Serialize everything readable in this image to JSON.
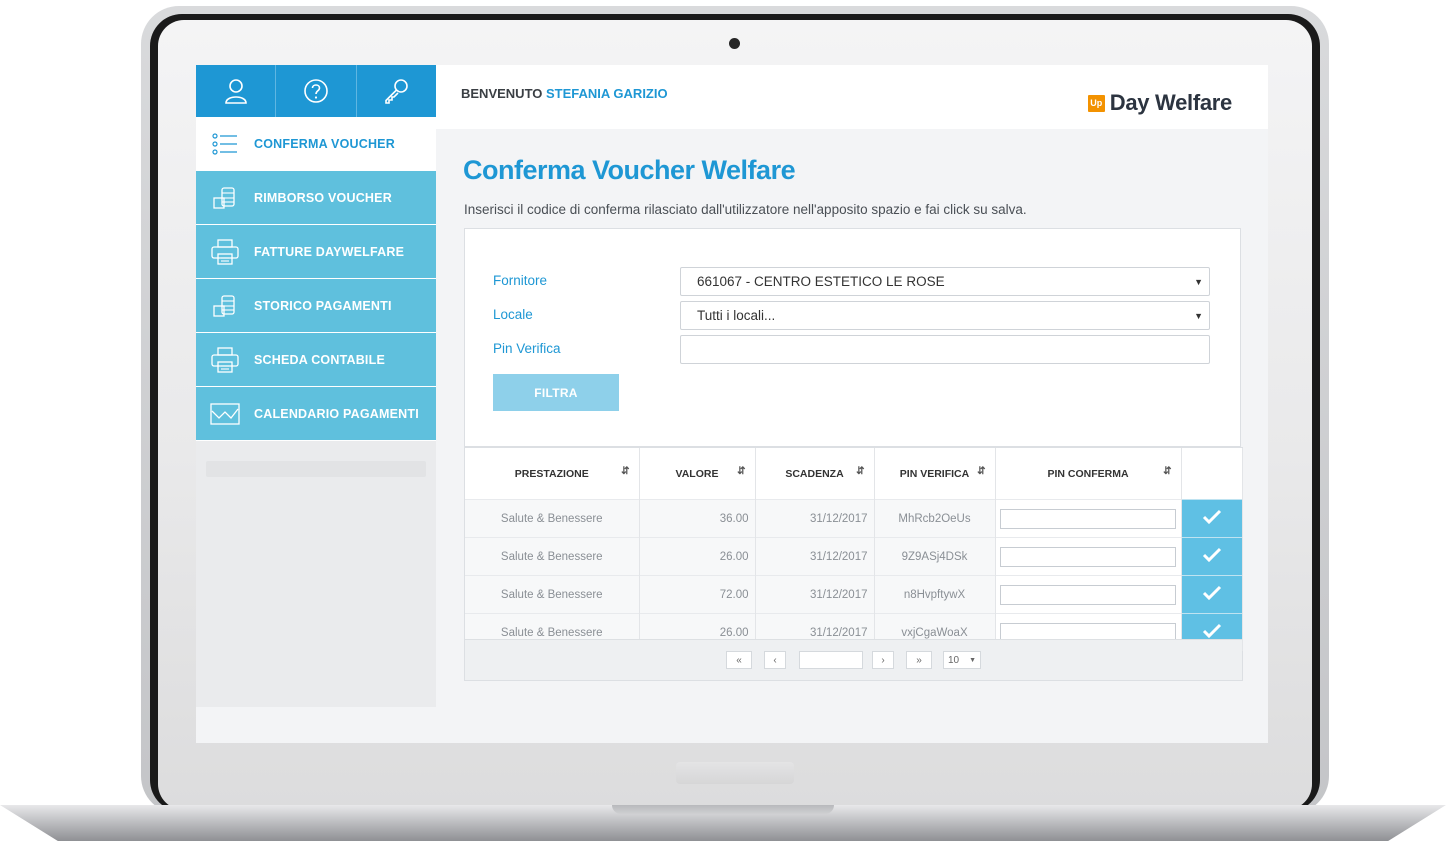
{
  "header": {
    "welcome_prefix": "BENVENUTO",
    "user_name": "STEFANIA GARIZIO",
    "brand_badge": "Up",
    "brand_name": "Day Welfare"
  },
  "sidebar": {
    "items": [
      {
        "label": "CONFERMA VOUCHER",
        "icon": "list-icon",
        "active": true
      },
      {
        "label": "RIMBORSO VOUCHER",
        "icon": "coins-icon",
        "active": false
      },
      {
        "label": "FATTURE DAYWELFARE",
        "icon": "printer-icon",
        "active": false
      },
      {
        "label": "STORICO PAGAMENTI",
        "icon": "coins-icon",
        "active": false
      },
      {
        "label": "SCHEDA CONTABILE",
        "icon": "printer-icon",
        "active": false
      },
      {
        "label": "CALENDARIO PAGAMENTI",
        "icon": "chart-icon",
        "active": false
      }
    ]
  },
  "page": {
    "title": "Conferma Voucher Welfare",
    "subtitle": "Inserisci il codice di conferma rilasciato dall'utilizzatore nell'apposito spazio e fai click su salva."
  },
  "filter": {
    "fornitore_label": "Fornitore",
    "fornitore_value": "661067 - CENTRO ESTETICO LE ROSE",
    "locale_label": "Locale",
    "locale_value": "Tutti i locali...",
    "pin_label": "Pin Verifica",
    "pin_value": "",
    "button_label": "FILTRA"
  },
  "table": {
    "columns": [
      "PRESTAZIONE",
      "VALORE",
      "SCADENZA",
      "PIN VERIFICA",
      "PIN CONFERMA"
    ],
    "rows": [
      {
        "prestazione": "Salute & Benessere",
        "valore": "36.00",
        "scadenza": "31/12/2017",
        "pin_verifica": "MhRcb2OeUs"
      },
      {
        "prestazione": "Salute & Benessere",
        "valore": "26.00",
        "scadenza": "31/12/2017",
        "pin_verifica": "9Z9ASj4DSk"
      },
      {
        "prestazione": "Salute & Benessere",
        "valore": "72.00",
        "scadenza": "31/12/2017",
        "pin_verifica": "n8HvpftywX"
      },
      {
        "prestazione": "Salute & Benessere",
        "valore": "26.00",
        "scadenza": "31/12/2017",
        "pin_verifica": "vxjCgaWoaX"
      }
    ]
  },
  "pager": {
    "first": "«",
    "prev": "‹",
    "page_value": "",
    "next": "›",
    "last": "»",
    "page_size": "10"
  },
  "colors": {
    "accent": "#1e97d4",
    "nav": "#5fc0dd",
    "brand_orange": "#f39200"
  }
}
